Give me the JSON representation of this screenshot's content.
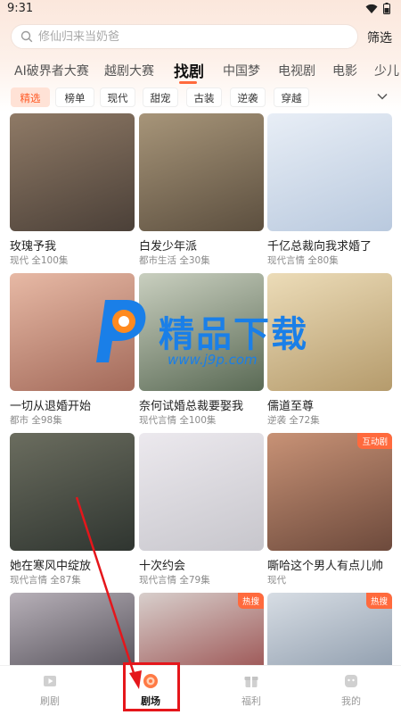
{
  "status_bar": {
    "time": "9:31"
  },
  "search": {
    "placeholder": "修仙归来当奶爸",
    "filter_label": "筛选"
  },
  "main_tabs": [
    {
      "label": "AI破界者大赛",
      "active": false
    },
    {
      "label": "越剧大赛",
      "active": false
    },
    {
      "label": "找剧",
      "active": true
    },
    {
      "label": "中国梦",
      "active": false
    },
    {
      "label": "电视剧",
      "active": false
    },
    {
      "label": "电影",
      "active": false
    },
    {
      "label": "少儿",
      "active": false
    }
  ],
  "chips": [
    {
      "label": "精选",
      "active": true
    },
    {
      "label": "榜单",
      "active": false
    },
    {
      "label": "现代",
      "active": false
    },
    {
      "label": "甜宠",
      "active": false
    },
    {
      "label": "古装",
      "active": false
    },
    {
      "label": "逆袭",
      "active": false
    },
    {
      "label": "穿越",
      "active": false
    }
  ],
  "dramas": [
    {
      "title": "玫瑰予我",
      "meta": "现代 全100集",
      "badge": "",
      "colors": [
        "#4b4038",
        "#8f7a66"
      ]
    },
    {
      "title": "白发少年派",
      "meta": "都市生活 全30集",
      "badge": "",
      "colors": [
        "#5c4f3f",
        "#a79579"
      ]
    },
    {
      "title": "千亿总裁向我求婚了",
      "meta": "现代言情 全80集",
      "badge": "",
      "colors": [
        "#b9c9de",
        "#e8eef6"
      ]
    },
    {
      "title": "一切从退婚开始",
      "meta": "都市 全98集",
      "badge": "",
      "colors": [
        "#a36a5a",
        "#e7b9a5"
      ]
    },
    {
      "title": "奈何试婚总裁要娶我",
      "meta": "现代言情 全100集",
      "badge": "",
      "colors": [
        "#5a6a55",
        "#c9cfbf"
      ]
    },
    {
      "title": "儒道至尊",
      "meta": "逆袭 全72集",
      "badge": "",
      "colors": [
        "#b59b6c",
        "#ecdcb8"
      ]
    },
    {
      "title": "她在寒风中绽放",
      "meta": "现代言情 全87集",
      "badge": "",
      "colors": [
        "#2f3530",
        "#6b6d5f"
      ]
    },
    {
      "title": "十次约会",
      "meta": "现代言情 全79集",
      "badge": "",
      "colors": [
        "#c7c6cc",
        "#ece9ee"
      ]
    },
    {
      "title": "嘶哈这个男人有点儿帅",
      "meta": "现代",
      "badge": "互动剧",
      "colors": [
        "#6d4a3c",
        "#c89276"
      ]
    },
    {
      "title": "",
      "meta": "",
      "badge": "",
      "colors": [
        "#37343d",
        "#b7b0b8"
      ]
    },
    {
      "title": "",
      "meta": "",
      "badge": "热搜",
      "colors": [
        "#8a2f2f",
        "#d8cfcc"
      ]
    },
    {
      "title": "",
      "meta": "",
      "badge": "热搜",
      "colors": [
        "#7a8a9d",
        "#d7dde4"
      ]
    }
  ],
  "watermark": {
    "text": "精品下载",
    "url": "www.j9p.com"
  },
  "bottom_nav": [
    {
      "label": "刷剧",
      "icon": "play-icon",
      "active": false
    },
    {
      "label": "剧场",
      "icon": "theater-icon",
      "active": true
    },
    {
      "label": "福利",
      "icon": "gift-icon",
      "active": false
    },
    {
      "label": "我的",
      "icon": "profile-icon",
      "active": false
    }
  ],
  "colors": {
    "accent": "#ff6a3d",
    "chip_active_bg": "#ffe2d6",
    "highlight": "#e5161b",
    "watermark": "#1a7fe8"
  }
}
